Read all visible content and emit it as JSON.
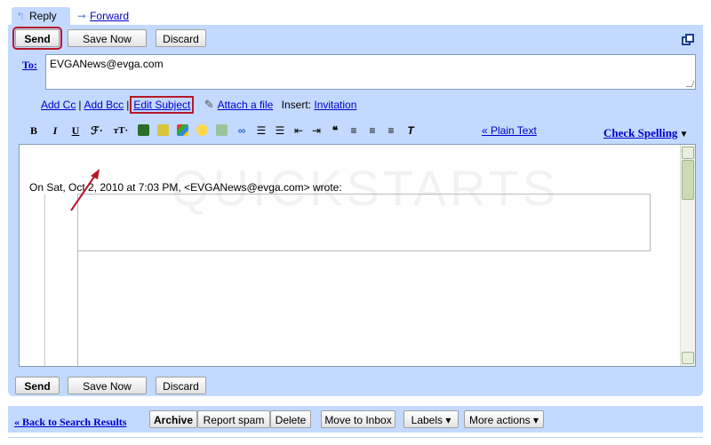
{
  "reply_bar": {
    "reply_label": "Reply",
    "forward_label": "Forward"
  },
  "top_buttons": {
    "send": "Send",
    "save_now": "Save Now",
    "discard": "Discard"
  },
  "to": {
    "label": "To:",
    "value": "EVGANews@evga.com"
  },
  "links": {
    "add_cc": "Add Cc",
    "add_bcc": "Add Bcc",
    "edit_subject": "Edit Subject",
    "attach_file": "Attach a file",
    "insert_label": "Insert:",
    "invitation": "Invitation"
  },
  "toolbar": {
    "bold": "B",
    "italic": "I",
    "underline": "U",
    "plain_text": "« Plain Text",
    "check_spelling": "Check Spelling"
  },
  "editor": {
    "quote_header": "On Sat, Oct 2, 2010 at 7:03 PM, <EVGANews@evga.com> wrote:",
    "watermark": "QUICKSTARTS"
  },
  "bottom_buttons": {
    "send": "Send",
    "save_now": "Save Now",
    "discard": "Discard"
  },
  "actions": {
    "back": "« Back to Search Results",
    "archive": "Archive",
    "report_spam": "Report spam",
    "delete": "Delete",
    "move_to_inbox": "Move to Inbox",
    "labels": "Labels ▾",
    "more_actions": "More actions ▾"
  },
  "colors": {
    "panel": "#c3d9ff",
    "highlight": "#b8182b",
    "link": "#0000cc"
  }
}
